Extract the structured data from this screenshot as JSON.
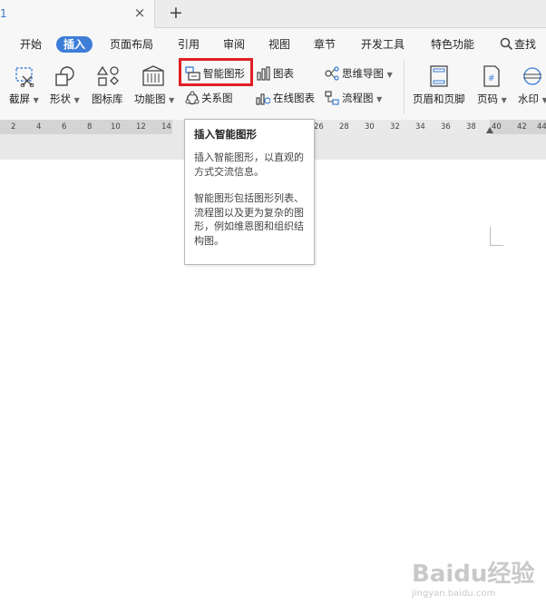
{
  "tabs": {
    "doc_title": "1",
    "close_glyph": "×",
    "new_tab_glyph": "+"
  },
  "menu": {
    "items": [
      "开始",
      "插入",
      "页面布局",
      "引用",
      "审阅",
      "视图",
      "章节",
      "开发工具",
      "特色功能"
    ],
    "active_index": 1,
    "search_label": "查找"
  },
  "toolbar": {
    "screenshot": "截屏",
    "shapes": "形状",
    "icon_library": "图标库",
    "function_chart": "功能图",
    "smart_art": "智能图形",
    "relation_chart": "关系图",
    "chart": "图表",
    "online_chart": "在线图表",
    "mind_map": "思维导图",
    "flowchart": "流程图",
    "header_footer": "页眉和页脚",
    "page_number": "页码",
    "watermark": "水印"
  },
  "ruler": {
    "numbers": [
      "2",
      "4",
      "6",
      "8",
      "10",
      "12",
      "14",
      "26",
      "28",
      "30",
      "32",
      "34",
      "36",
      "38",
      "40",
      "42",
      "44"
    ]
  },
  "tooltip": {
    "title": "插入智能图形",
    "para1": "插入智能图形，以直观的方式交流信息。",
    "para2": "智能图形包括图形列表、流程图以及更为复杂的图形，例如维恩图和组织结构图。"
  },
  "watermark": {
    "brand": "Baidu经验",
    "url": "jingyan.baidu.com"
  },
  "colors": {
    "accent": "#3d7dd8",
    "highlight_border": "#e01e26",
    "tab_text": "#3a78c3"
  }
}
